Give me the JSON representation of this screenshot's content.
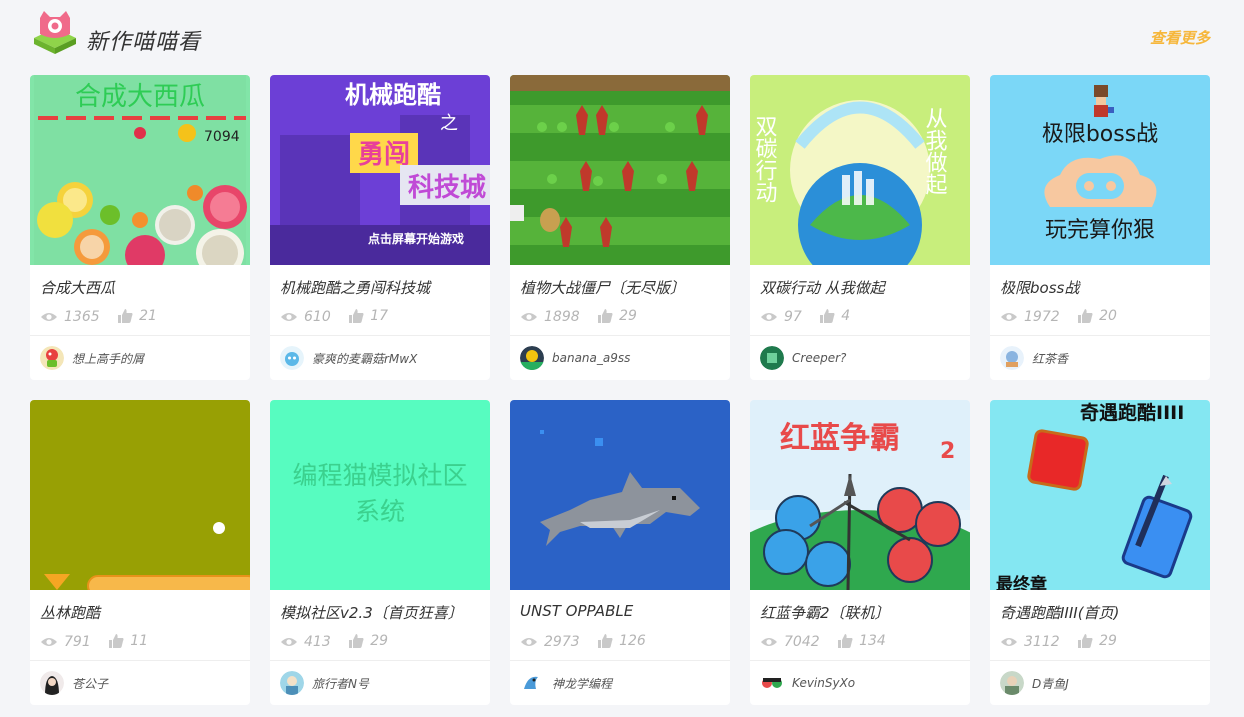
{
  "section": {
    "title": "新作喵喵看",
    "more_label": "查看更多",
    "accent_color": "#f6b73c"
  },
  "cards": [
    {
      "title": "合成大西瓜",
      "views": "1365",
      "likes": "21",
      "author": "想上高手的屑",
      "thumb_text": [
        "合成大西瓜",
        "7094"
      ]
    },
    {
      "title": "机械跑酷之勇闯科技城",
      "views": "610",
      "likes": "17",
      "author": "豪爽的麦霸菇rMwX",
      "thumb_text": [
        "机械跑酷",
        "之",
        "勇闯",
        "科技城",
        "点击屏幕开始游戏"
      ]
    },
    {
      "title": "植物大战僵尸〔无尽版〕",
      "views": "1898",
      "likes": "29",
      "author": "banana_a9ss",
      "thumb_text": []
    },
    {
      "title": "双碳行动 从我做起",
      "views": "97",
      "likes": "4",
      "author": "Creeper?",
      "thumb_text": [
        "双碳行动",
        "从我做起"
      ]
    },
    {
      "title": "极限boss战",
      "views": "1972",
      "likes": "20",
      "author": "红茶香",
      "thumb_text": [
        "极限boss战",
        "玩完算你狠"
      ]
    },
    {
      "title": "丛林跑酷",
      "views": "791",
      "likes": "11",
      "author": "苍公子",
      "thumb_text": []
    },
    {
      "title": "模拟社区v2.3〔首页狂喜〕",
      "views": "413",
      "likes": "29",
      "author": "旅行者N号",
      "thumb_text": [
        "编程猫模拟社区",
        "系统"
      ]
    },
    {
      "title": "UNST OPPABLE",
      "views": "2973",
      "likes": "126",
      "author": "神龙学编程",
      "thumb_text": []
    },
    {
      "title": "红蓝争霸2〔联机〕",
      "views": "7042",
      "likes": "134",
      "author": "KevinSyXo",
      "thumb_text": [
        "红蓝争霸",
        "2"
      ]
    },
    {
      "title": "奇遇跑酷IIII(首页)",
      "views": "3112",
      "likes": "29",
      "author": "D青鱼J",
      "thumb_text": [
        "奇遇跑酷IIII",
        "最终章"
      ]
    }
  ]
}
